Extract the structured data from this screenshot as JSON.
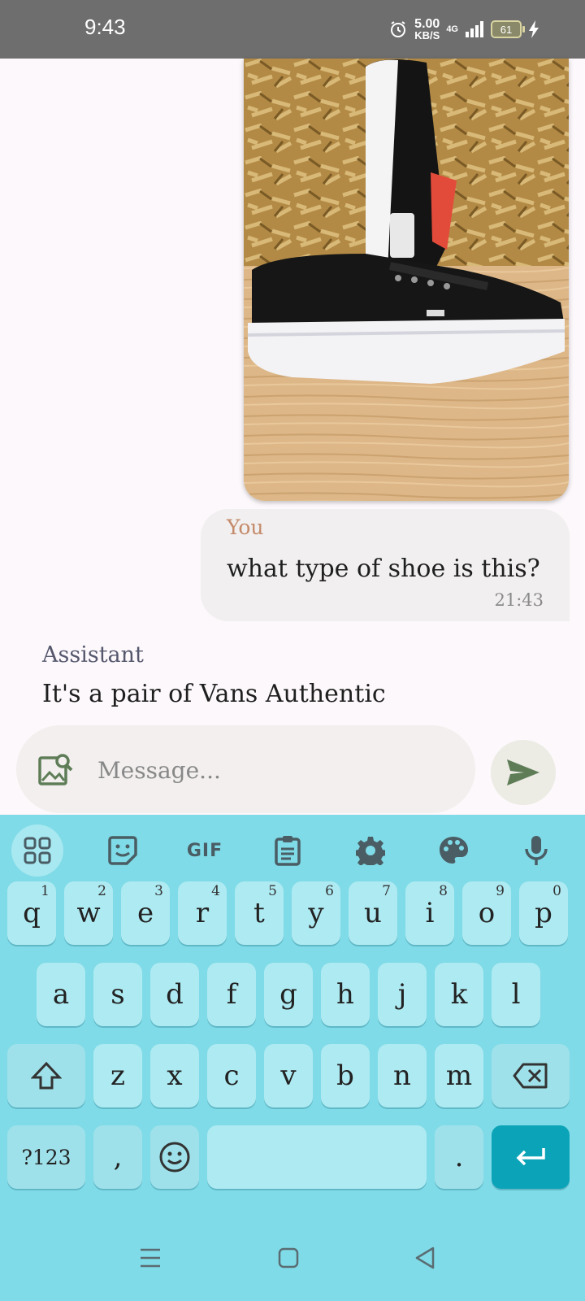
{
  "status_bar": {
    "time": "9:43",
    "speed_value": "5.00",
    "speed_unit": "KB/S",
    "network": "4G",
    "battery": "61"
  },
  "chat": {
    "image_alt": "black Vans sneakers photo",
    "user_message": {
      "sender": "You",
      "text": "what type of shoe is this?",
      "time": "21:43"
    },
    "assistant_message": {
      "sender": "Assistant",
      "text": "It's a pair of Vans Authentic"
    }
  },
  "input": {
    "placeholder": "Message..."
  },
  "keyboard": {
    "toolbar": [
      "grid-icon",
      "sticker-icon",
      "GIF",
      "clipboard-icon",
      "gear-icon",
      "palette-icon",
      "microphone-icon"
    ],
    "gif_label": "GIF",
    "row1": [
      {
        "k": "q",
        "n": "1"
      },
      {
        "k": "w",
        "n": "2"
      },
      {
        "k": "e",
        "n": "3"
      },
      {
        "k": "r",
        "n": "4"
      },
      {
        "k": "t",
        "n": "5"
      },
      {
        "k": "y",
        "n": "6"
      },
      {
        "k": "u",
        "n": "7"
      },
      {
        "k": "i",
        "n": "8"
      },
      {
        "k": "o",
        "n": "9"
      },
      {
        "k": "p",
        "n": "0"
      }
    ],
    "row2": [
      "a",
      "s",
      "d",
      "f",
      "g",
      "h",
      "j",
      "k",
      "l"
    ],
    "row3": [
      "z",
      "x",
      "c",
      "v",
      "b",
      "n",
      "m"
    ],
    "symbols_label": "?123",
    "comma": ",",
    "period": "."
  },
  "colors": {
    "keyboard_bg": "#7fdbe7",
    "key_bg": "#aeeaf2",
    "enter_bg": "#0ba3b8",
    "send_icon": "#5e7d57",
    "user_sender": "#c48a6a"
  }
}
